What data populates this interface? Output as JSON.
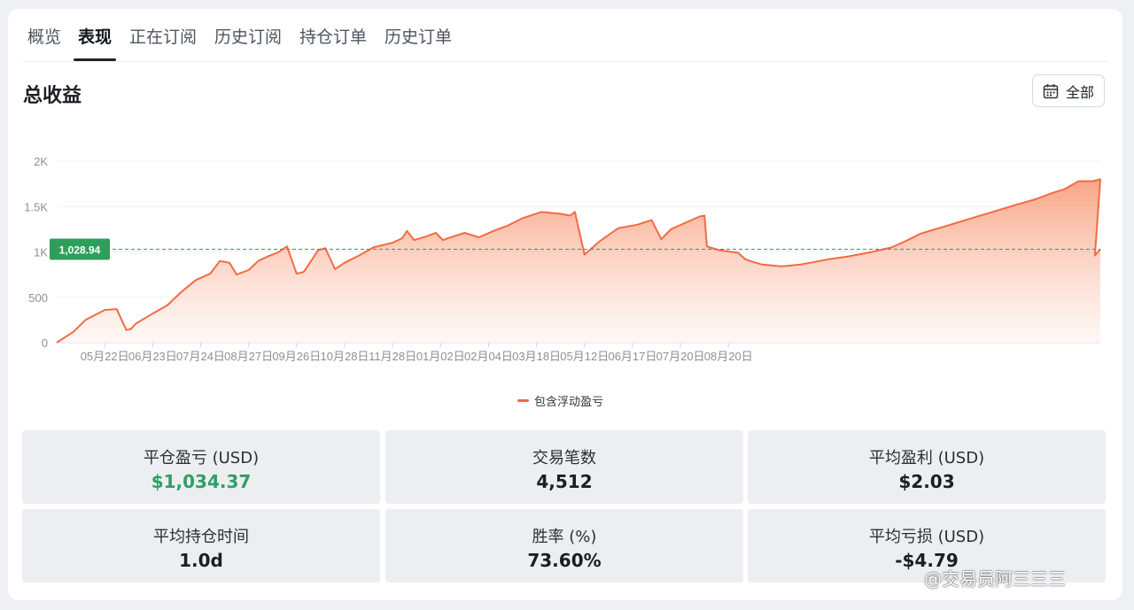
{
  "tabs": [
    {
      "label": "概览"
    },
    {
      "label": "表现"
    },
    {
      "label": "正在订阅"
    },
    {
      "label": "历史订阅"
    },
    {
      "label": "持仓订单"
    },
    {
      "label": "历史订单"
    }
  ],
  "active_tab": "表现",
  "section": {
    "title": "总收益",
    "range_button": "全部",
    "range_icon": "calendar-icon"
  },
  "chart_data": {
    "type": "area",
    "title": "",
    "xlabel": "",
    "ylabel": "",
    "ylim": [
      0,
      2000
    ],
    "y_ticks": [
      "0",
      "500",
      "1K",
      "1.5K",
      "2K"
    ],
    "x_tick_labels": [
      "05月22日",
      "06月23日",
      "07月24日",
      "08月27日",
      "09月26日",
      "10月28日",
      "11月28日",
      "01月02日",
      "02月04日",
      "03月18日",
      "05月12日",
      "06月17日",
      "07月20日",
      "08月20日"
    ],
    "reference_line": {
      "value": 1028.94,
      "label": "1,028.94",
      "color": "#2e9e5b"
    },
    "colors": {
      "line": "#f26b43",
      "fill_top": "#f7a080",
      "fill_bottom": "#fff4ef"
    },
    "legend": "bottom-center",
    "grid": true,
    "series": [
      {
        "name": "包含浮动盈亏",
        "x": [
          0,
          0.35,
          0.6,
          1.0,
          1.25,
          1.45,
          1.55,
          1.65,
          2.0,
          2.3,
          2.6,
          2.9,
          3.2,
          3.4,
          3.6,
          3.75,
          4.0,
          4.2,
          4.4,
          4.6,
          4.8,
          5.0,
          5.15,
          5.3,
          5.45,
          5.6,
          5.8,
          6.0,
          6.3,
          6.6,
          7.0,
          7.2,
          7.3,
          7.45,
          7.7,
          7.9,
          8.05,
          8.15,
          8.5,
          8.8,
          9.1,
          9.4,
          9.7,
          10.1,
          10.5,
          10.7,
          10.8,
          11.0,
          11.3,
          11.7,
          12.1,
          12.4,
          12.6,
          12.8,
          13.1,
          13.4,
          13.5,
          13.55,
          13.8,
          14.2,
          14.35,
          14.45,
          14.7,
          15.1,
          15.5,
          15.8,
          16.1,
          16.5,
          17.0,
          17.4,
          17.7,
          18.0,
          18.5,
          19.0,
          19.5,
          20.0,
          20.4,
          20.6,
          20.75,
          21.0,
          21.3,
          21.6,
          21.75
        ],
        "values": [
          0,
          120,
          250,
          360,
          370,
          140,
          150,
          210,
          320,
          410,
          560,
          690,
          760,
          900,
          880,
          750,
          800,
          900,
          950,
          990,
          1060,
          760,
          780,
          900,
          1020,
          1040,
          810,
          880,
          960,
          1050,
          1100,
          1150,
          1230,
          1130,
          1170,
          1210,
          1130,
          1150,
          1210,
          1160,
          1230,
          1290,
          1370,
          1440,
          1420,
          1400,
          1440,
          970,
          1110,
          1260,
          1300,
          1350,
          1140,
          1250,
          1320,
          1390,
          1400,
          1060,
          1020,
          990,
          920,
          900,
          860,
          840,
          860,
          890,
          920,
          950,
          1000,
          1050,
          1120,
          1200,
          1280,
          1360,
          1440,
          1520,
          1580,
          1620,
          1650,
          1690,
          1780,
          1780,
          1800
        ]
      }
    ]
  },
  "stats": [
    {
      "label": "平仓盈亏 (USD)",
      "value": "$1,034.37",
      "positive": true
    },
    {
      "label": "交易笔数",
      "value": "4,512"
    },
    {
      "label": "平均盈利 (USD)",
      "value": "$2.03"
    },
    {
      "label": "平均持仓时间",
      "value": "1.0d"
    },
    {
      "label": "胜率 (%)",
      "value": "73.60%"
    },
    {
      "label": "平均亏损 (USD)",
      "value": "-$4.79"
    }
  ],
  "watermark": "@交易员阿三三三"
}
